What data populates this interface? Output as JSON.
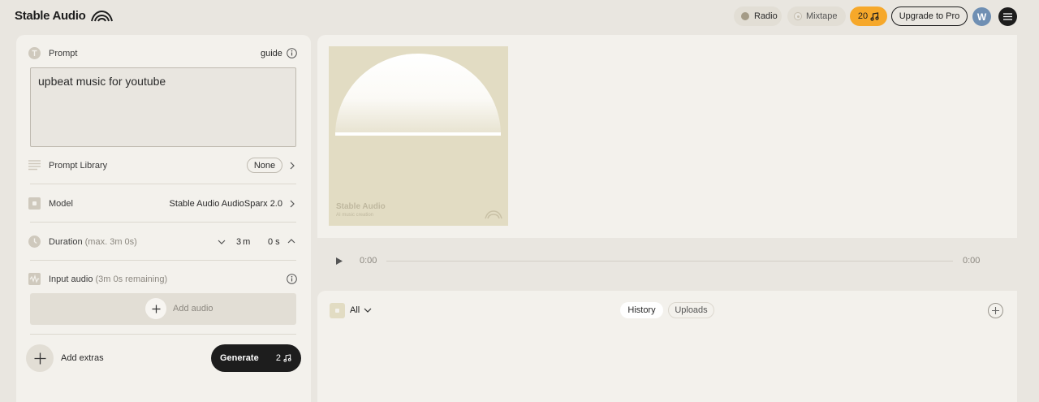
{
  "header": {
    "logo_text": "Stable Audio",
    "radio_label": "Radio",
    "mixtape_label": "Mixtape",
    "credits": "20",
    "upgrade_label": "Upgrade to Pro",
    "avatar_initial": "W"
  },
  "prompt": {
    "label": "Prompt",
    "guide_label": "guide",
    "value": "upbeat music for youtube"
  },
  "prompt_library": {
    "label": "Prompt Library",
    "selected": "None"
  },
  "model": {
    "label": "Model",
    "value": "Stable Audio AudioSparx 2.0"
  },
  "duration": {
    "label": "Duration",
    "hint": "(max. 3m 0s)",
    "minutes": "3",
    "minutes_unit": "m",
    "seconds": "0",
    "seconds_unit": "s"
  },
  "input_audio": {
    "label": "Input audio",
    "hint": "(3m 0s remaining)",
    "add_label": "Add audio"
  },
  "footer": {
    "add_extras_label": "Add extras",
    "generate_label": "Generate",
    "generate_cost": "2"
  },
  "artwork": {
    "brand": "Stable Audio",
    "subtitle": "AI music creation"
  },
  "player": {
    "current_time": "0:00",
    "total_time": "0:00"
  },
  "library": {
    "filter_label": "All",
    "tabs": [
      "History",
      "Uploads"
    ]
  },
  "colors": {
    "accent": "#f6a82a",
    "dark": "#1d1d1d",
    "background": "#e9e6e0",
    "panel": "#f3f1ec"
  }
}
